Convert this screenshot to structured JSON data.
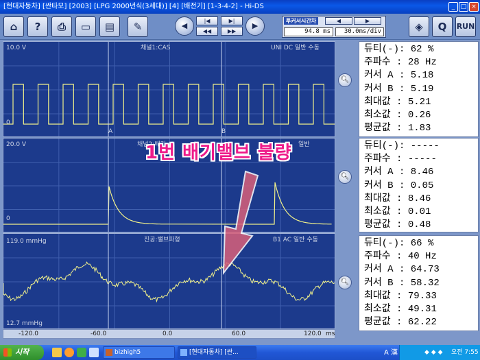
{
  "window": {
    "title": "[현대자동차] [싼타모] [2003] [LPG 2000년식(3세대)] [4] [배전기] [1-3-4-2] - Hi-DS"
  },
  "toolbar": {
    "cursor_title": "투커서시간차",
    "time_diff": "94.8 ms",
    "time_div": "30.0ms/div",
    "q_label": "Q",
    "run_label": "RUN"
  },
  "channels": [
    {
      "label": "10.0 V",
      "title": "채널1:CAS",
      "mode": "UNI DC  일반 수동",
      "bottom": "0"
    },
    {
      "label": "20.0 V",
      "title": "채널2:배기",
      "mode": "일반",
      "bottom": "0"
    },
    {
      "label": "119.0 mmHg",
      "title": "진공:밸브파형",
      "mode": "B1  AC  일반 수동",
      "bottom": "12.7 mmHg"
    }
  ],
  "markers": {
    "a": "A",
    "b": "B"
  },
  "info_panels": [
    {
      "rows": [
        "듀티(-): 62 %",
        "주파수 : 28 Hz",
        "커서 A : 5.18",
        "커서 B : 5.19",
        "최대값 : 5.21",
        "최소값 : 0.26",
        "평균값 : 1.83"
      ]
    },
    {
      "rows": [
        "듀티(-): -----",
        "주파수 : -----",
        "커서 A : 8.46",
        "커서 B : 0.05",
        "최대값 : 8.46",
        "최소값 : 0.01",
        "평균값 : 0.48"
      ]
    },
    {
      "rows": [
        "듀티(-): 66 %",
        "주파수 : 40 Hz",
        "커서 A : 64.73",
        "커서 B : 58.32",
        "최대값 : 79.33",
        "최소값 : 49.31",
        "평균값 : 62.22"
      ]
    }
  ],
  "xaxis": {
    "ticks": [
      "-120.0",
      "-60.0",
      "0.0",
      "60.0",
      "120.0"
    ],
    "unit": "ms"
  },
  "annotation": {
    "text": "1번 배기밸브 불량"
  },
  "taskbar": {
    "start": "시작",
    "tasks": [
      "bizhigh5",
      "[현대자동차] [싼..."
    ],
    "clock": "오전 7:55",
    "lang": "A 漢"
  },
  "colors": {
    "trace": "#f1f18a",
    "panel_bg": "#1c3a8c",
    "grid": "#3f5fae",
    "annotation": "#ee1a8a",
    "arrow": "#d9607a"
  }
}
